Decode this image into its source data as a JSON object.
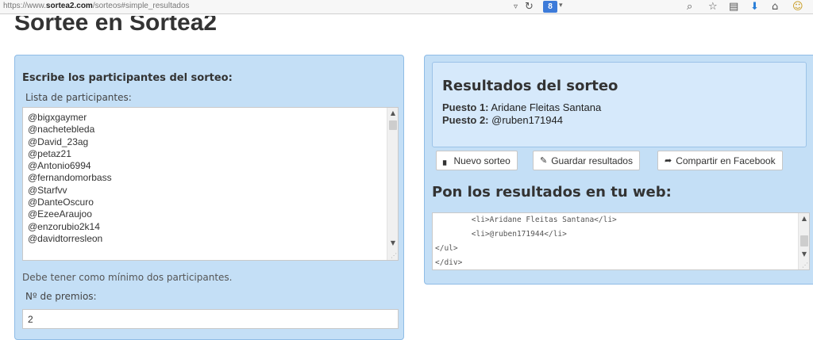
{
  "browser": {
    "url_prefix": "https://www.",
    "url_host": "sortea2.com",
    "url_path": "/sorteos#simple_resultados",
    "search_engine_badge": "8",
    "icons": [
      "dropdown-arrow",
      "refresh",
      "search",
      "star",
      "bookmarks",
      "download",
      "home",
      "addon"
    ]
  },
  "page": {
    "title": "Sortee en Sortea2"
  },
  "left": {
    "heading": "Escribe los participantes del sorteo:",
    "list_label": "Lista de participantes:",
    "participants": [
      "@bigxgaymer",
      "@nachetebleda",
      "@David_23ag",
      "@petaz21",
      "@Antonio6994",
      "@fernandomorbass",
      "@Starfvv",
      "@DanteOscuro",
      "@EzeeAraujoo",
      "@enzorubio2k14",
      "@davidtorresleon"
    ],
    "hint": "Debe tener como mínimo dos participantes.",
    "prizes_label": "Nº de premios:",
    "prizes_value": "2"
  },
  "right": {
    "results_title": "Resultados del sorteo",
    "places": [
      {
        "label": "Puesto 1:",
        "name": "Aridane Fleitas Santana"
      },
      {
        "label": "Puesto 2:",
        "name": "@ruben171944"
      }
    ],
    "buttons": {
      "new": "Nuevo sorteo",
      "save": "Guardar resultados",
      "share": "Compartir en Facebook"
    },
    "embed_title": "Pon los resultados en tu web:",
    "code_lines": [
      "        <li>Aridane Fleitas Santana</li>",
      "        <li>@ruben171944</li>",
      "</ul>",
      "</div>"
    ]
  }
}
